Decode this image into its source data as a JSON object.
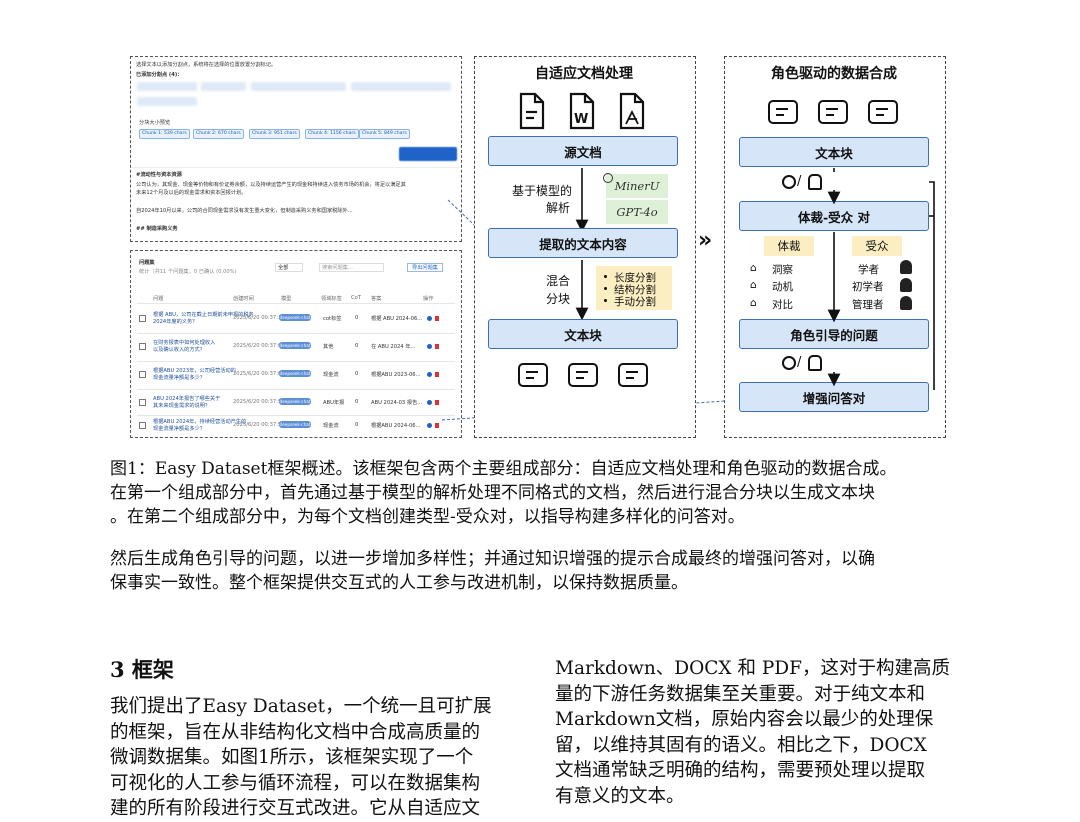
{
  "screenshot_top": {
    "hint_line": "选择文本以添加分割点，系统将在选择的位置放置分割标记。",
    "added_points_label": "已添加分割点 (4)：",
    "size_preview_label": "分块大小预览",
    "chunk_chips": [
      "Chunk 1: 539 chars",
      "Chunk 2: 670 chars",
      "Chunk 3: 951 chars",
      "Chunk 4: 1156 chars",
      "Chunk 5: 849 chars"
    ],
    "section_heading": "#流动性与资本资源",
    "para1": "公司认为，其现金、现金等价物和有价证券余额，以及持续运营产生的现金和持续进入债务市场的机会，将足以满足其",
    "para1b": "未来12个月及以后的现金需求和资本回报计划。",
    "para2": "自2024年10月以来，公司的合同现金需求没有发生重大变化，但制造采购义务和国家税除外...",
    "section_heading2": "## 制造采购义务"
  },
  "screenshot_bottom": {
    "title": "问题集",
    "subtitle": "统计（共11 个问题集，0 已确认 (0.00%)",
    "filter_all": "全部",
    "search_placeholder": "搜索问题集...",
    "export_button": "导出问题集",
    "columns": [
      "问题",
      "创建时间",
      "模型",
      "领域标签",
      "CoT",
      "答案",
      "操作"
    ],
    "rows": [
      {
        "q": "根据 ABU，公司在截止日期前未申报的税务",
        "q2": "2024年度的义务？",
        "time": "2025/6/20 00:37:16",
        "model": "deepseek-chat",
        "tag": "cot标签",
        "cot": "0",
        "ans": "根据 ABU 2024-06..."
      },
      {
        "q": "在财务报表中如何处理收入",
        "q2": "以及确认收入的方式？",
        "time": "2025/6/20 00:37:04",
        "model": "deepseek-chat",
        "tag": "其他",
        "cot": "0",
        "ans": "在 ABU 2024 年..."
      },
      {
        "q": "根据ABU 2023年，公司经营活动的",
        "q2": "现金流量净额是多少？",
        "time": "2025/6/20 00:37:01",
        "model": "deepseek-chat",
        "tag": "现金流",
        "cot": "0",
        "ans": "根据ABU 2023-06..."
      },
      {
        "q": "ABU 2024年报告了哪些关于",
        "q2": "其未来现金需求的说明？",
        "time": "2025/6/20 00:37:57",
        "model": "deepseek-chat",
        "tag": "ABU年报",
        "cot": "0",
        "ans": "ABU 2024-03 报告..."
      },
      {
        "q": "根据ABU 2024年，持续经营活动产生的",
        "q2": "现金流量净额是多少？",
        "time": "2025/6/20 00:37:57",
        "model": "deepseek-chat",
        "tag": "现金流",
        "cot": "0",
        "ans": "根据ABU 2024-06..."
      }
    ]
  },
  "left_panel": {
    "title": "自适应文档处理",
    "source_doc": "源文档",
    "model_parse_1": "基于模型的",
    "model_parse_2": "解析",
    "parser_1": "MinerU",
    "parser_2": "GPT-4o",
    "extracted": "提取的文本内容",
    "hybrid_1": "混合",
    "hybrid_2": "分块",
    "split_methods": [
      "长度分割",
      "结构分割",
      "手动分割"
    ],
    "text_chunk": "文本块",
    "doc_icon_labels": [
      "W"
    ]
  },
  "right_panel": {
    "title": "角色驱动的数据合成",
    "text_chunk": "文本块",
    "genre_audience": "体裁-受众 对",
    "genre_label": "体裁",
    "audience_label": "受众",
    "genres": [
      "洞察",
      "动机",
      "对比"
    ],
    "audiences": [
      "学者",
      "初学者",
      "管理者"
    ],
    "role_question": "角色引导的问题",
    "enhanced_qa": "增强问答对",
    "slash": "/"
  },
  "arrow": "»",
  "caption": {
    "line1": "图1：Easy Dataset框架概述。该框架包含两个主要组成部分：自适应文档处理和角色驱动的数据合成。",
    "line2": "在第一个组成部分中，首先通过基于模型的解析处理不同格式的文档，然后进行混合分块以生成文本块",
    "line3": "。在第二个组成部分中，为每个文档创建类型-受众对，以指导构建多样化的问答对。",
    "line4": "然后生成角色引导的问题，以进一步增加多样性；并通过知识增强的提示合成最终的增强问答对，以确",
    "line5": "保事实一致性。整个框架提供交互式的人工参与改进机制，以保持数据质量。"
  },
  "section": {
    "heading": "3 框架",
    "left_lines": [
      "我们提出了Easy Dataset，一个统一且可扩展",
      "的框架，旨在从非结构化文档中合成高质量的",
      "微调数据集。如图1所示，该框架实现了一个",
      "可视化的人工参与循环流程，可以在数据集构",
      "建的所有阶段进行交互式改进。它从自适应文"
    ],
    "right_lines": [
      "Markdown、DOCX 和 PDF，这对于构建高质",
      "量的下游任务数据集至关重要。对于纯文本和",
      "Markdown文档，原始内容会以最少的处理保",
      "留，以维持其固有的语义。相比之下，DOCX",
      "文档通常缺乏明确的结构，需要预处理以提取",
      "有意义的文本。"
    ]
  }
}
